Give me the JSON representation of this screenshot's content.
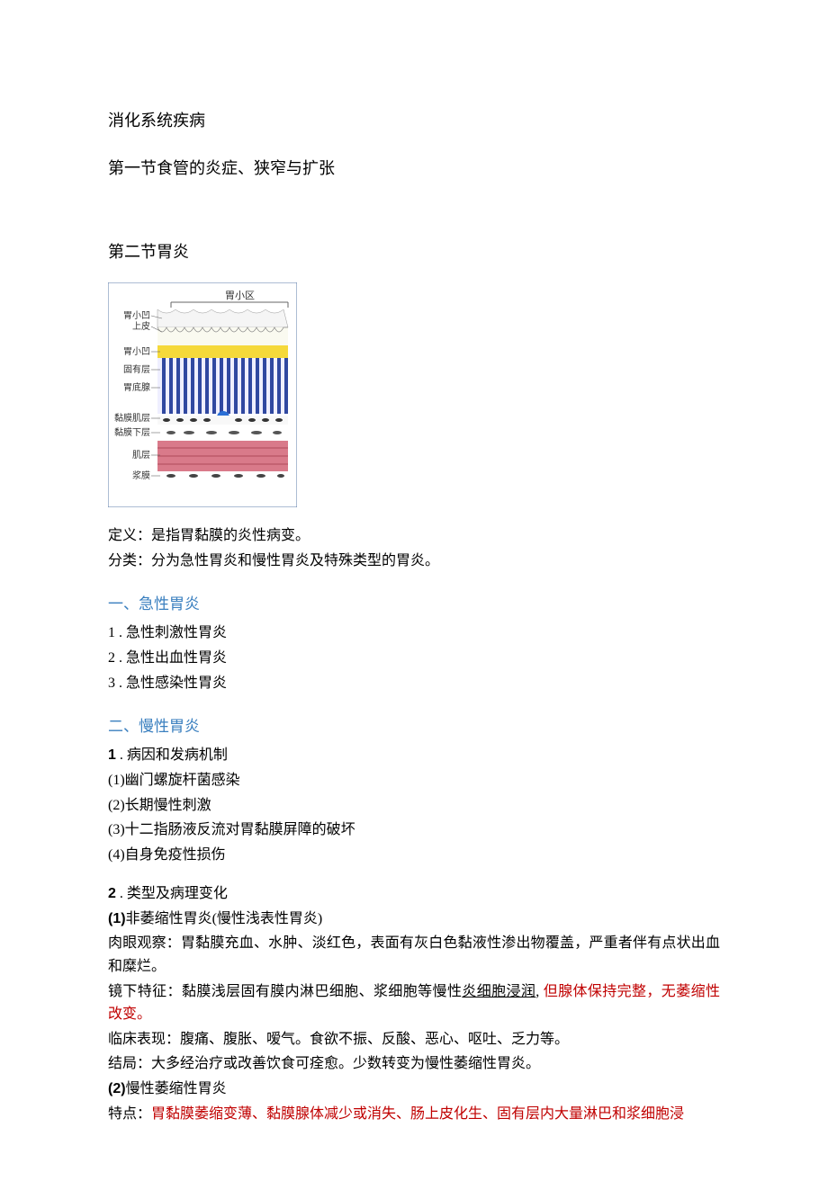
{
  "title": "消化系统疾病",
  "section1_heading": "第一节食管的炎症、狭窄与扩张",
  "section2_heading": "第二节胃炎",
  "diagram": {
    "top_label": "胃小区",
    "labels": [
      "胃小凹",
      "上皮",
      "胃小凹",
      "固有层",
      "胃底腺",
      "黏膜肌层",
      "黏膜下层",
      "肌层",
      "浆膜"
    ]
  },
  "definition_line": "定义：是指胃黏膜的炎性病变。",
  "classification_line": "分类：分为急性胃炎和慢性胃炎及特殊类型的胃炎。",
  "acute": {
    "heading": "一、急性胃炎",
    "items": [
      "1 . 急性刺激性胃炎",
      "2  . 急性出血性胃炎",
      "3  . 急性感染性胃炎"
    ]
  },
  "chronic": {
    "heading": "二、慢性胃炎",
    "cause_heading_num": "1",
    "cause_heading_text": " . 病因和发病机制",
    "causes": [
      "(1)幽门螺旋杆菌感染",
      "(2)长期慢性刺激",
      "(3)十二指肠液反流对胃黏膜屏障的破坏",
      "(4)自身免疫性损伤"
    ],
    "types_heading_num": "2",
    "types_heading_text": " . 类型及病理变化",
    "type1_num": "(1)",
    "type1_title": "非萎缩性胃炎(慢性浅表性胃炎)",
    "type1_macro": "肉眼观察：胃黏膜充血、水肿、淡红色，表面有灰白色黏液性渗出物覆盖，严重者伴有点状出血和糜烂。",
    "type1_micro_pre": "镜下特征：黏膜浅层固有膜内淋巴细胞、浆细胞等慢性",
    "type1_micro_underline": "炎细胞浸润",
    "type1_micro_mid": ", ",
    "type1_micro_red": "但腺体保持完整，无萎缩性改变。",
    "type1_clinical": "临床表现：腹痛、腹胀、嗳气。食欲不振、反酸、恶心、呕吐、乏力等。",
    "type1_outcome": "结局：大多经治疗或改善饮食可痊愈。少数转变为慢性萎缩性胃炎。",
    "type2_num": "(2)",
    "type2_title": "慢性萎缩性胃炎",
    "type2_feature_label": "特点：",
    "type2_feature_red": "胃黏膜萎缩变薄、黏膜腺体减少或消失、肠上皮化生、固有层内大量淋巴和浆细胞浸"
  }
}
